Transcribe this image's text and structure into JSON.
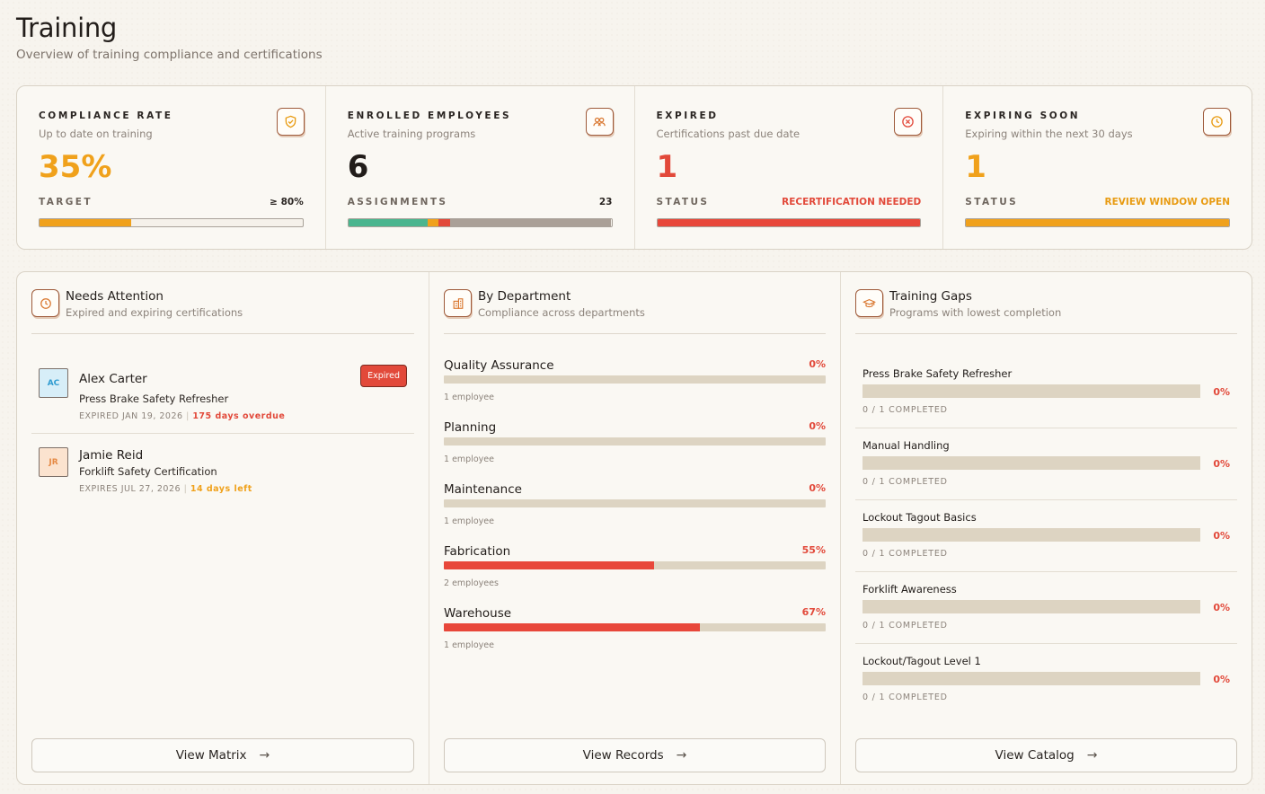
{
  "header": {
    "title": "Training",
    "subtitle": "Overview of training compliance and certifications"
  },
  "stats": [
    {
      "label": "COMPLIANCE RATE",
      "description": "Up to date on training",
      "value": "35%",
      "value_color": "#f0a11b",
      "icon": "shield-check-icon",
      "sub_label": "TARGET",
      "sub_value": "≥ 80%",
      "sub_value_color": "#2a2522",
      "progress_segments": [
        {
          "fraction": 0.35,
          "color": "#f0a11b"
        }
      ]
    },
    {
      "label": "ENROLLED EMPLOYEES",
      "description": "Active training programs",
      "value": "6",
      "value_color": "#221d1a",
      "icon": "users-icon",
      "sub_label": "ASSIGNMENTS",
      "sub_value": "23",
      "sub_value_color": "#2a2522",
      "progress_segments": [
        {
          "fraction": 0.3,
          "color": "#4ab58e"
        },
        {
          "fraction": 0.044,
          "color": "#f0a11b"
        },
        {
          "fraction": 0.044,
          "color": "#e2493a"
        },
        {
          "fraction": 0.612,
          "color": "#aaa097"
        }
      ]
    },
    {
      "label": "EXPIRED",
      "description": "Certifications past due date",
      "value": "1",
      "value_color": "#e2493a",
      "icon": "x-circle-icon",
      "sub_label": "STATUS",
      "sub_value": "RECERTIFICATION NEEDED",
      "sub_value_color": "#e2493a",
      "progress_segments": [
        {
          "fraction": 1.0,
          "color": "#e8473a"
        }
      ]
    },
    {
      "label": "EXPIRING SOON",
      "description": "Expiring within the next 30 days",
      "value": "1",
      "value_color": "#f0a11b",
      "icon": "clock-icon",
      "sub_label": "STATUS",
      "sub_value": "REVIEW WINDOW OPEN",
      "sub_value_color": "#e89b12",
      "progress_segments": [
        {
          "fraction": 1.0,
          "color": "#f0a11b"
        }
      ]
    }
  ],
  "attention": {
    "title": "Needs Attention",
    "description": "Expired and expiring certifications",
    "items": [
      {
        "initials": "AC",
        "avatar_bg": "#d7eef8",
        "avatar_fg": "#2f9bd0",
        "name": "Alex Carter",
        "course": "Press Brake Safety Refresher",
        "date": "EXPIRED JAN 19, 2026",
        "separator": "|",
        "status_text": "175 days overdue",
        "status_color": "#e2493a",
        "badge": "Expired"
      },
      {
        "initials": "JR",
        "avatar_bg": "#fbe3cf",
        "avatar_fg": "#e58a45",
        "name": "Jamie Reid",
        "course": "Forklift Safety Certification",
        "date": "EXPIRES JUL 27, 2026",
        "separator": "|",
        "status_text": "14 days left",
        "status_color": "#f0a11b",
        "badge": ""
      }
    ],
    "button": "View Matrix"
  },
  "departments": {
    "title": "By Department",
    "description": "Compliance across departments",
    "items": [
      {
        "name": "Quality Assurance",
        "percent_label": "0%",
        "fraction": 0,
        "count": "1 employee"
      },
      {
        "name": "Planning",
        "percent_label": "0%",
        "fraction": 0,
        "count": "1 employee"
      },
      {
        "name": "Maintenance",
        "percent_label": "0%",
        "fraction": 0,
        "count": "1 employee"
      },
      {
        "name": "Fabrication",
        "percent_label": "55%",
        "fraction": 0.55,
        "count": "2 employees"
      },
      {
        "name": "Warehouse",
        "percent_label": "67%",
        "fraction": 0.67,
        "count": "1 employee"
      }
    ],
    "button": "View Records"
  },
  "gaps": {
    "title": "Training Gaps",
    "description": "Programs with lowest completion",
    "items": [
      {
        "name": "Press Brake Safety Refresher",
        "percent_label": "0%",
        "completed": "0 / 1 COMPLETED"
      },
      {
        "name": "Manual Handling",
        "percent_label": "0%",
        "completed": "0 / 1 COMPLETED"
      },
      {
        "name": "Lockout Tagout Basics",
        "percent_label": "0%",
        "completed": "0 / 1 COMPLETED"
      },
      {
        "name": "Forklift Awareness",
        "percent_label": "0%",
        "completed": "0 / 1 COMPLETED"
      },
      {
        "name": "Lockout/Tagout Level 1",
        "percent_label": "0%",
        "completed": "0 / 1 COMPLETED"
      }
    ],
    "button": "View Catalog"
  },
  "icons": {
    "attention": "clock-icon",
    "departments": "building-icon",
    "gaps": "graduation-cap-icon",
    "button_arrow": "arrow-right-icon"
  },
  "colors": {
    "accent_orange": "#f0a11b",
    "accent_red": "#e2493a",
    "icon_stroke": "#d9762e"
  }
}
